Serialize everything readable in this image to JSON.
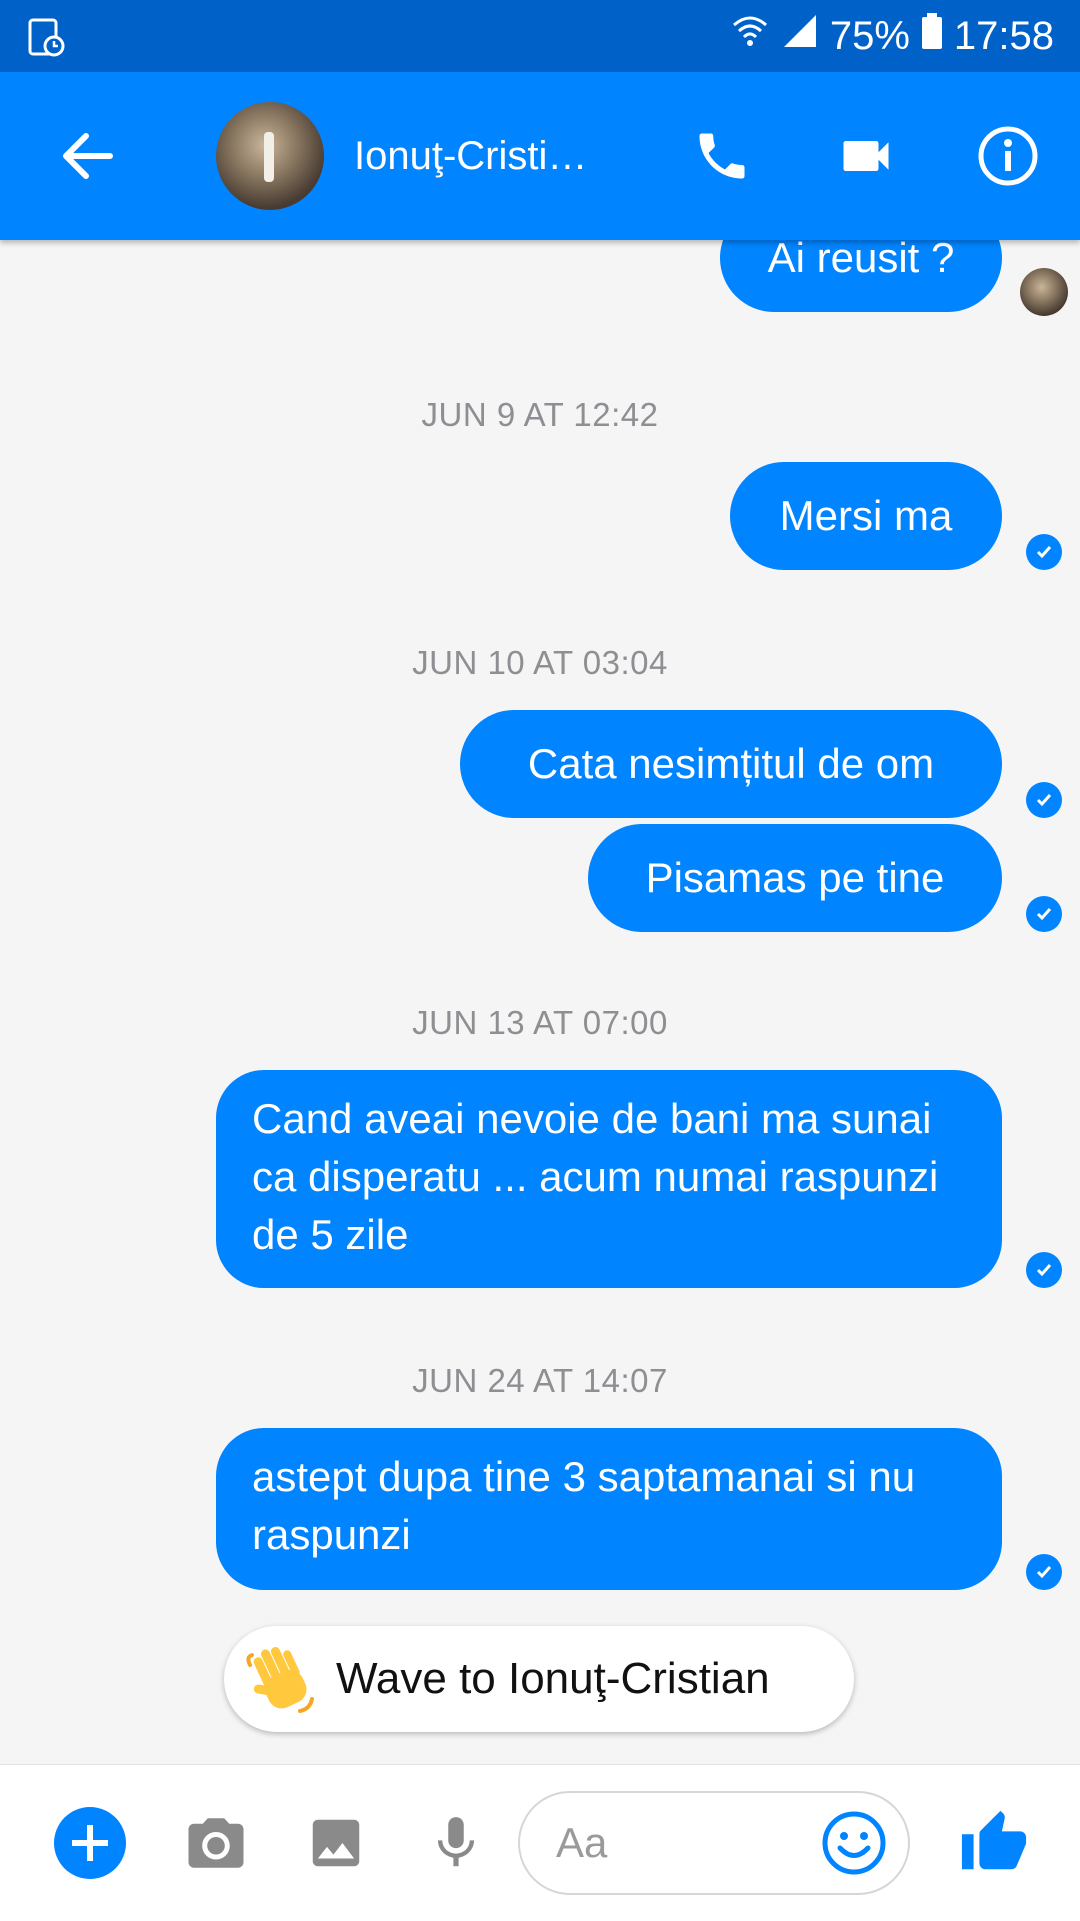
{
  "status_bar": {
    "battery": "75%",
    "time": "17:58"
  },
  "header": {
    "contact_name": "Ionuţ-Cristi…"
  },
  "conversation": {
    "first_message": "Ai reusit ?",
    "groups": [
      {
        "timestamp": "JUN 9 AT 12:42",
        "messages": [
          "Mersi ma"
        ]
      },
      {
        "timestamp": "JUN 10 AT 03:04",
        "messages": [
          "Cata nesimțitul de om",
          "Pisamas pe tine"
        ]
      },
      {
        "timestamp": "JUN 13 AT 07:00",
        "messages": [
          "Cand aveai nevoie de bani ma sunai ca disperatu ... acum numai raspunzi de 5 zile"
        ]
      },
      {
        "timestamp": "JUN 24 AT 14:07",
        "messages": [
          "astept dupa tine 3 saptamanai si nu raspunzi"
        ]
      }
    ]
  },
  "wave_button": {
    "label": "Wave to Ionuţ-Cristian"
  },
  "composer": {
    "placeholder": "Aa"
  },
  "colors": {
    "brand": "#0084ff",
    "status_bar": "#0062c9"
  },
  "icons": [
    "back-arrow-icon",
    "phone-icon",
    "video-call-icon",
    "info-icon",
    "plus-icon",
    "camera-icon",
    "gallery-icon",
    "microphone-icon",
    "emoji-icon",
    "thumbs-up-icon",
    "waving-hand-icon",
    "read-check-icon"
  ]
}
